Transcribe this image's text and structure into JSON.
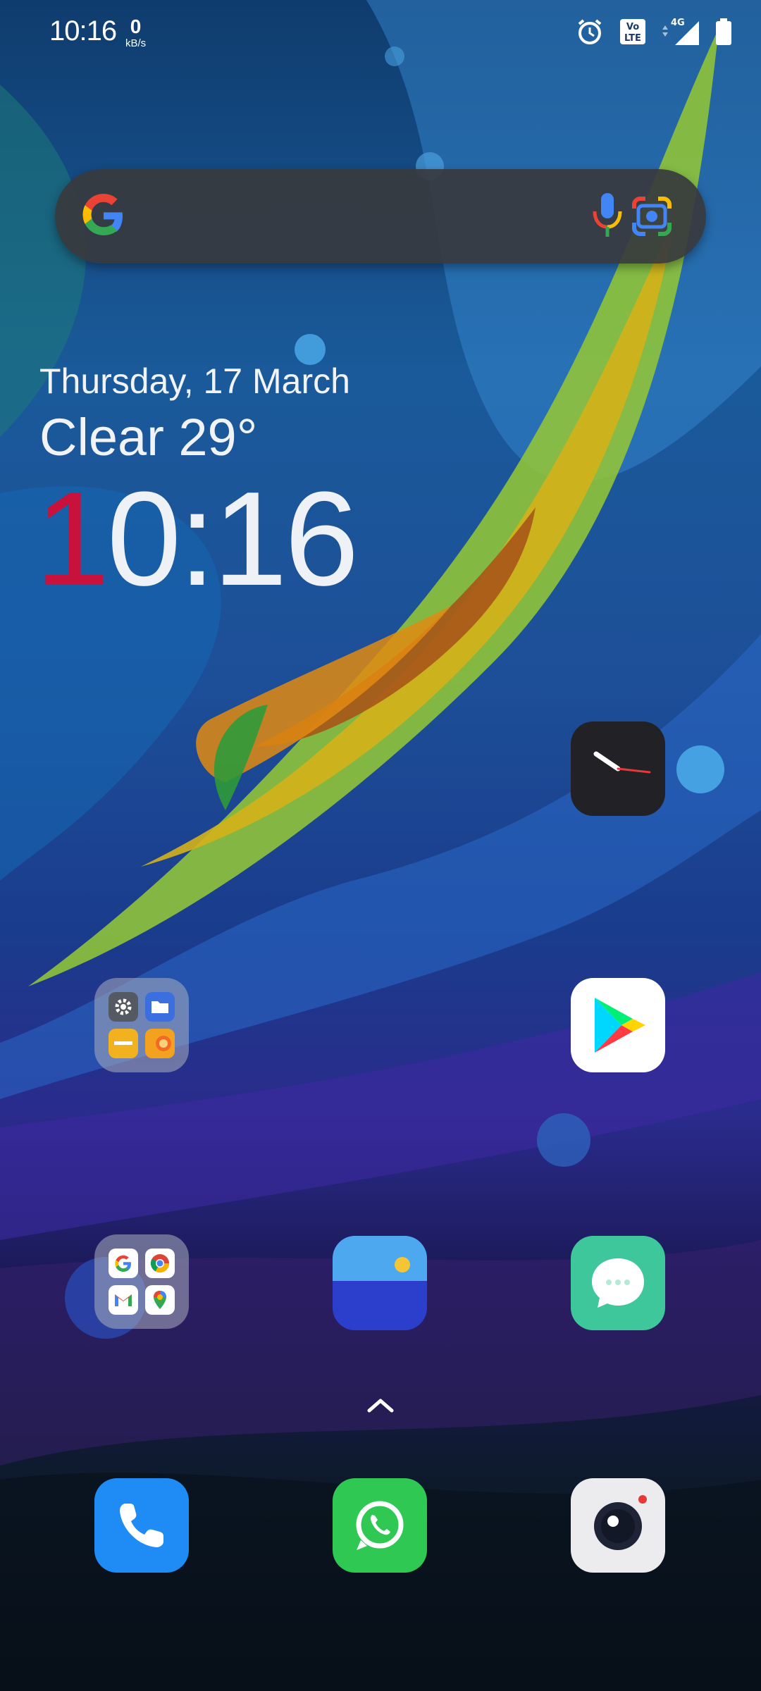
{
  "status_bar": {
    "time": "10:16",
    "net_speed_value": "0",
    "net_speed_unit": "kB/s",
    "icons": [
      "alarm-icon",
      "volte-icon",
      "4g-signal-icon",
      "battery-icon"
    ]
  },
  "search_bar": {
    "icons": [
      "google-g-icon",
      "microphone-icon",
      "google-lens-icon"
    ]
  },
  "widget": {
    "date": "Thursday, 17 March",
    "weather": "Clear 29°",
    "clock_first_digit": "1",
    "clock_rest": "0:16"
  },
  "home_apps": [
    {
      "name": "clock-app-icon"
    },
    {
      "name": "tools-folder",
      "contents": [
        "settings-icon",
        "files-icon",
        "notes-icon",
        "recorder-icon"
      ]
    },
    {
      "name": "play-store-app-icon"
    },
    {
      "name": "google-folder",
      "contents": [
        "google-icon",
        "chrome-icon",
        "gmail-icon",
        "maps-icon"
      ]
    },
    {
      "name": "gallery-app-icon"
    },
    {
      "name": "messages-app-icon"
    }
  ],
  "dock": [
    "phone-app-icon",
    "whatsapp-app-icon",
    "camera-app-icon"
  ],
  "colors": {
    "clock_accent": "#c8123c",
    "search_bar_bg": "#37393e",
    "phone_blue": "#1f8cf5",
    "whatsapp_green": "#2fc852",
    "messages_green": "#3ec79a",
    "gallery_blue": "#2c3fcc"
  }
}
